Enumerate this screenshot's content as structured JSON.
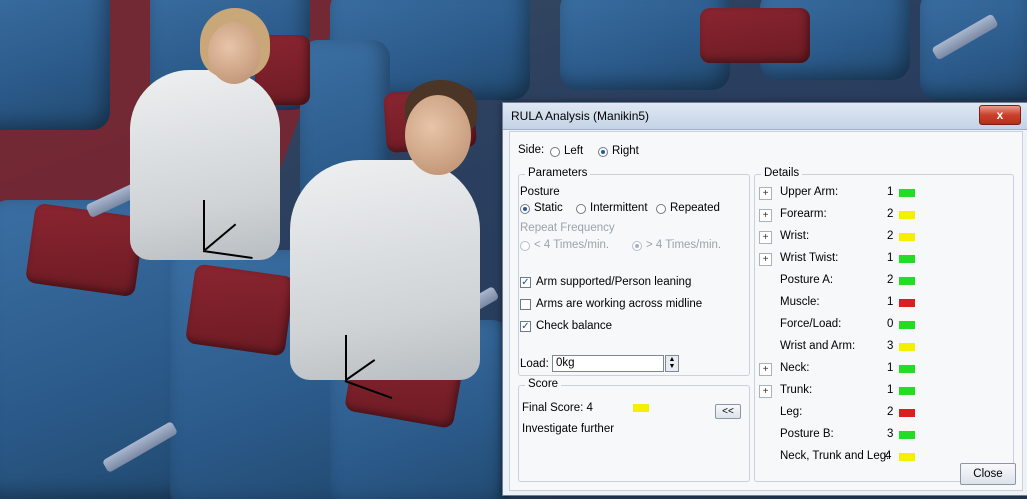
{
  "dialog": {
    "title": "RULA Analysis (Manikin5)",
    "close_glyph": "x",
    "close_button": "Close"
  },
  "side": {
    "label": "Side:",
    "options": [
      "Left",
      "Right"
    ],
    "selected": "Right"
  },
  "parameters": {
    "group_label": "Parameters",
    "posture_label": "Posture",
    "posture_options": [
      "Static",
      "Intermittent",
      "Repeated"
    ],
    "posture_selected": "Static",
    "repeat_label": "Repeat Frequency",
    "repeat_options": [
      "< 4 Times/min.",
      "> 4 Times/min."
    ],
    "repeat_selected": "> 4 Times/min.",
    "checks": [
      {
        "label": "Arm supported/Person leaning",
        "checked": true
      },
      {
        "label": "Arms are working across midline",
        "checked": false
      },
      {
        "label": "Check balance",
        "checked": true
      }
    ],
    "load_label": "Load:",
    "load_value": "0kg"
  },
  "score": {
    "group_label": "Score",
    "final_label": "Final Score: 4",
    "final_color": "#f5ef00",
    "message": "Investigate further",
    "collapse_button": "<<"
  },
  "details": {
    "group_label": "Details",
    "rows": [
      {
        "label": "Upper Arm:",
        "value": "1",
        "color": "#22dd22",
        "expandable": true
      },
      {
        "label": "Forearm:",
        "value": "2",
        "color": "#f5ef00",
        "expandable": true
      },
      {
        "label": "Wrist:",
        "value": "2",
        "color": "#f5ef00",
        "expandable": true
      },
      {
        "label": "Wrist Twist:",
        "value": "1",
        "color": "#22dd22",
        "expandable": true
      },
      {
        "label": "Posture A:",
        "value": "2",
        "color": "#22dd22",
        "expandable": false
      },
      {
        "label": "Muscle:",
        "value": "1",
        "color": "#dd1e1e",
        "expandable": false
      },
      {
        "label": "Force/Load:",
        "value": "0",
        "color": "#22dd22",
        "expandable": false
      },
      {
        "label": "Wrist and Arm:",
        "value": "3",
        "color": "#f5ef00",
        "expandable": false
      },
      {
        "label": "Neck:",
        "value": "1",
        "color": "#22dd22",
        "expandable": true
      },
      {
        "label": "Trunk:",
        "value": "1",
        "color": "#22dd22",
        "expandable": true
      },
      {
        "label": "Leg:",
        "value": "2",
        "color": "#dd1e1e",
        "expandable": false
      },
      {
        "label": "Posture B:",
        "value": "3",
        "color": "#22dd22",
        "expandable": false
      },
      {
        "label": "Neck, Trunk and Leg:",
        "value": "4",
        "color": "#f5ef00",
        "expandable": false
      }
    ]
  }
}
